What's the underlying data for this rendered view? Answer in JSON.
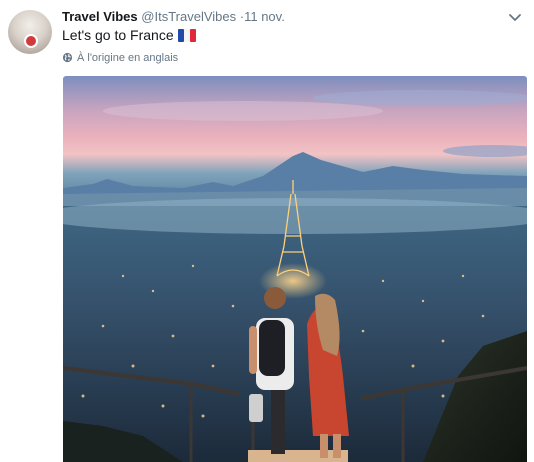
{
  "tweet": {
    "display_name": "Travel Vibes",
    "handle": "@ItsTravelVibes",
    "separator": "·",
    "timestamp": "11 nov.",
    "text": "Let's go to France",
    "flag_icon": "france-flag-icon",
    "translation_link": "À l'origine en anglais",
    "menu_icon": "chevron-down-icon",
    "colors": {
      "text": "#14171a",
      "secondary": "#657786"
    }
  }
}
